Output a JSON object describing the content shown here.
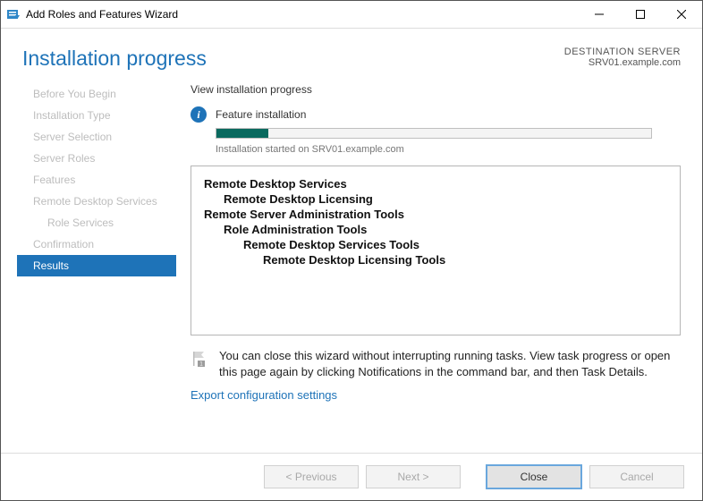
{
  "window": {
    "title": "Add Roles and Features Wizard"
  },
  "header": {
    "title": "Installation progress",
    "destination_label": "DESTINATION SERVER",
    "destination_value": "SRV01.example.com"
  },
  "sidebar": {
    "steps": [
      "Before You Begin",
      "Installation Type",
      "Server Selection",
      "Server Roles",
      "Features",
      "Remote Desktop Services",
      "Role Services",
      "Confirmation",
      "Results"
    ],
    "active_index": 8
  },
  "main": {
    "heading": "View installation progress",
    "status_label": "Feature installation",
    "progress_percent": 12,
    "progress_subtext": "Installation started on SRV01.example.com",
    "items": [
      "Remote Desktop Services",
      "Remote Desktop Licensing",
      "Remote Server Administration Tools",
      "Role Administration Tools",
      "Remote Desktop Services Tools",
      "Remote Desktop Licensing Tools"
    ],
    "note": "You can close this wizard without interrupting running tasks. View task progress or open this page again by clicking Notifications in the command bar, and then Task Details.",
    "export_link": "Export configuration settings"
  },
  "footer": {
    "previous": "< Previous",
    "next": "Next >",
    "close": "Close",
    "cancel": "Cancel"
  },
  "colors": {
    "accent": "#1e73b8",
    "progress_fill": "#0a6a5f"
  }
}
